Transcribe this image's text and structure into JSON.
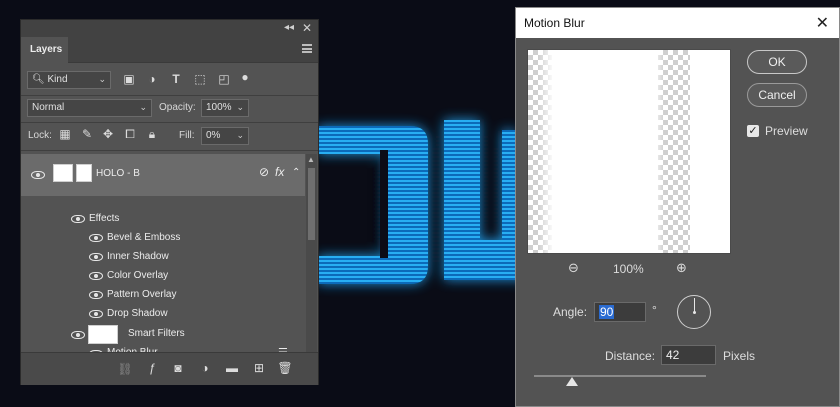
{
  "layers_panel": {
    "tab_label": "Layers",
    "filter": {
      "selected": "Kind"
    },
    "blend_mode": {
      "selected": "Normal"
    },
    "opacity": {
      "label": "Opacity:",
      "value": "100%"
    },
    "lock": {
      "label": "Lock:"
    },
    "fill": {
      "label": "Fill:",
      "value": "0%"
    },
    "layer": {
      "name": "HOLO - B",
      "fx": "fx"
    },
    "effects": {
      "header": "Effects",
      "items": [
        "Bevel & Emboss",
        "Inner Shadow",
        "Color Overlay",
        "Pattern Overlay",
        "Drop Shadow"
      ]
    },
    "smart_filters": {
      "label": "Smart Filters",
      "items": [
        "Motion Blur"
      ]
    }
  },
  "motion_blur": {
    "title": "Motion Blur",
    "ok_label": "OK",
    "cancel_label": "Cancel",
    "preview_label": "Preview",
    "preview_checked": true,
    "zoom": "100%",
    "angle": {
      "label": "Angle:",
      "value": "90",
      "unit": "°"
    },
    "distance": {
      "label": "Distance:",
      "value": "42",
      "unit": "Pixels"
    },
    "distance_slider_fraction": 0.22
  },
  "colors": {
    "panel_bg": "#535353",
    "neon": "#21a7f2",
    "selection": "#2a6bd1"
  }
}
